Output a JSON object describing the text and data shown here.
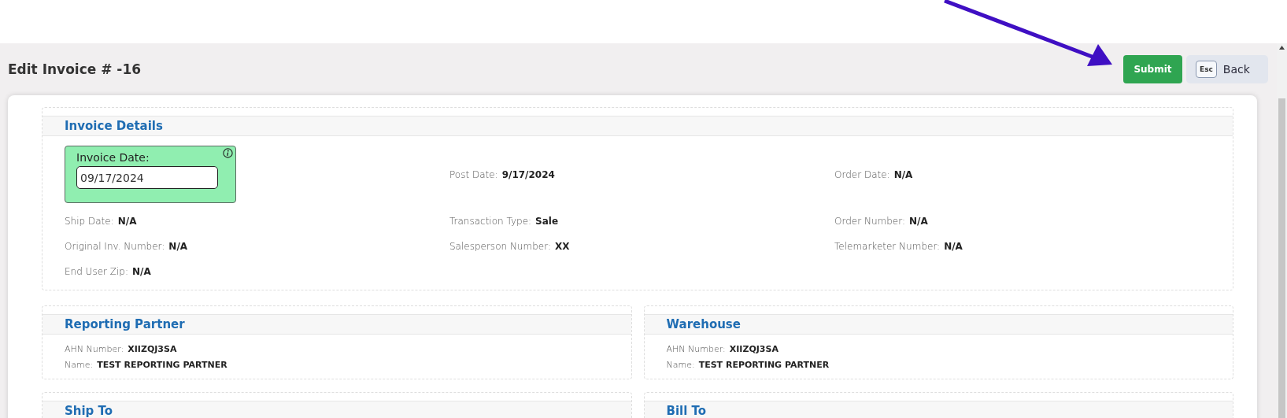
{
  "page": {
    "title": "Edit Invoice # -16"
  },
  "actions": {
    "submit": "Submit",
    "back_key": "Esc",
    "back": "Back"
  },
  "invoice_details": {
    "title": "Invoice Details",
    "invoice_date": {
      "label": "Invoice Date:",
      "value": "09/17/2024"
    },
    "fields": [
      {
        "label": "Post Date:",
        "value": "9/17/2024"
      },
      {
        "label": "Order Date:",
        "value": "N/A"
      },
      {
        "label": "Ship Date:",
        "value": "N/A"
      },
      {
        "label": "Transaction Type:",
        "value": "Sale"
      },
      {
        "label": "Order Number:",
        "value": "N/A"
      },
      {
        "label": "Original Inv. Number:",
        "value": "N/A"
      },
      {
        "label": "Salesperson Number:",
        "value": "XX"
      },
      {
        "label": "Telemarketer Number:",
        "value": "N/A"
      },
      {
        "label": "End User Zip:",
        "value": "N/A"
      }
    ]
  },
  "sections": [
    {
      "title": "Reporting Partner",
      "fields": [
        {
          "label": "AHN Number:",
          "value": "XIIZQJ3SA"
        },
        {
          "label": "Name:",
          "value": "TEST REPORTING PARTNER"
        }
      ]
    },
    {
      "title": "Warehouse",
      "fields": [
        {
          "label": "AHN Number:",
          "value": "XIIZQJ3SA"
        },
        {
          "label": "Name:",
          "value": "TEST REPORTING PARTNER"
        }
      ]
    },
    {
      "title": "Ship To"
    },
    {
      "title": "Bill To"
    }
  ]
}
